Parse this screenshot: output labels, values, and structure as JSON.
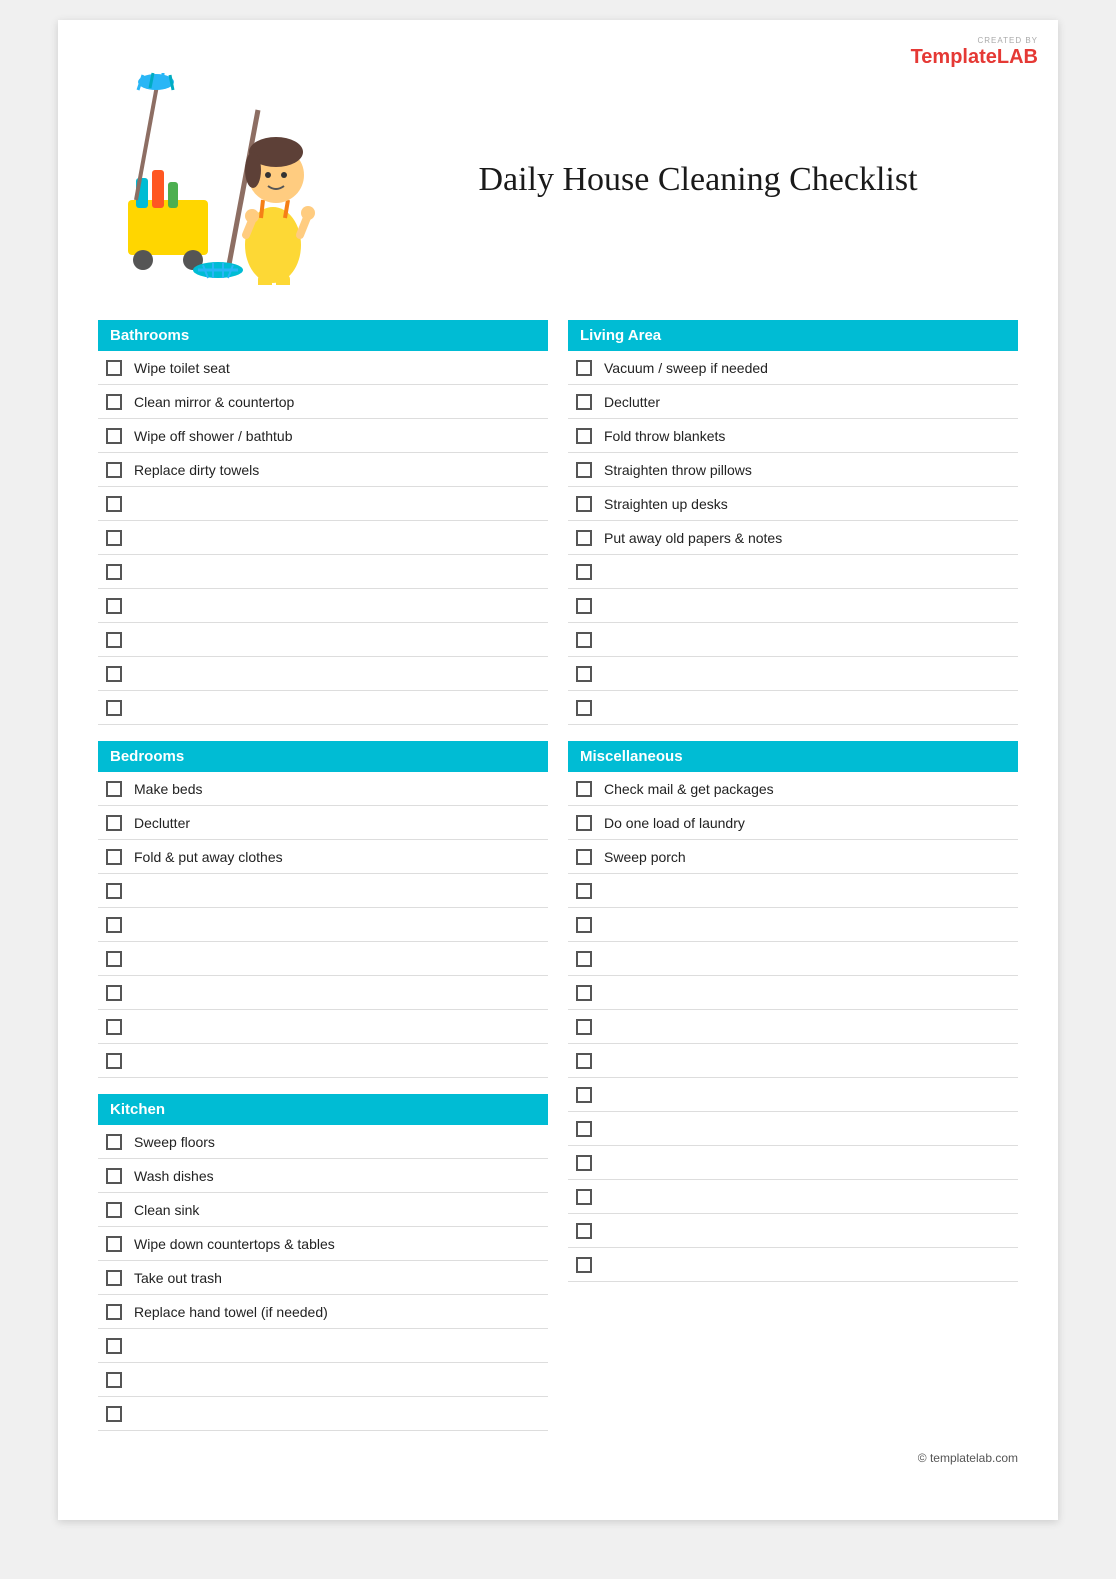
{
  "brand": {
    "created_by": "CREATED BY",
    "name_template": "Template",
    "name_lab": "LAB"
  },
  "page_title": "Daily House Cleaning Checklist",
  "sections": {
    "bathrooms": {
      "title": "Bathrooms",
      "items": [
        "Wipe toilet seat",
        "Clean mirror & countertop",
        "Wipe off shower / bathtub",
        "Replace dirty towels",
        "",
        "",
        "",
        "",
        "",
        "",
        ""
      ]
    },
    "living_area": {
      "title": "Living Area",
      "items": [
        "Vacuum / sweep if needed",
        "Declutter",
        "Fold throw blankets",
        "Straighten throw pillows",
        "Straighten up desks",
        "Put away old papers & notes",
        "",
        "",
        "",
        "",
        ""
      ]
    },
    "bedrooms": {
      "title": "Bedrooms",
      "items": [
        "Make beds",
        "Declutter",
        "Fold & put away clothes",
        "",
        "",
        "",
        "",
        "",
        ""
      ]
    },
    "miscellaneous": {
      "title": "Miscellaneous",
      "items": [
        "Check mail & get packages",
        "Do one load of laundry",
        "Sweep porch",
        "",
        "",
        "",
        "",
        "",
        "",
        "",
        "",
        "",
        "",
        "",
        ""
      ]
    },
    "kitchen": {
      "title": "Kitchen",
      "items": [
        "Sweep floors",
        "Wash dishes",
        "Clean sink",
        "Wipe down countertops & tables",
        "Take out trash",
        "Replace hand towel (if needed)",
        "",
        "",
        ""
      ]
    }
  },
  "footer": {
    "text": "© templatelab.com"
  }
}
